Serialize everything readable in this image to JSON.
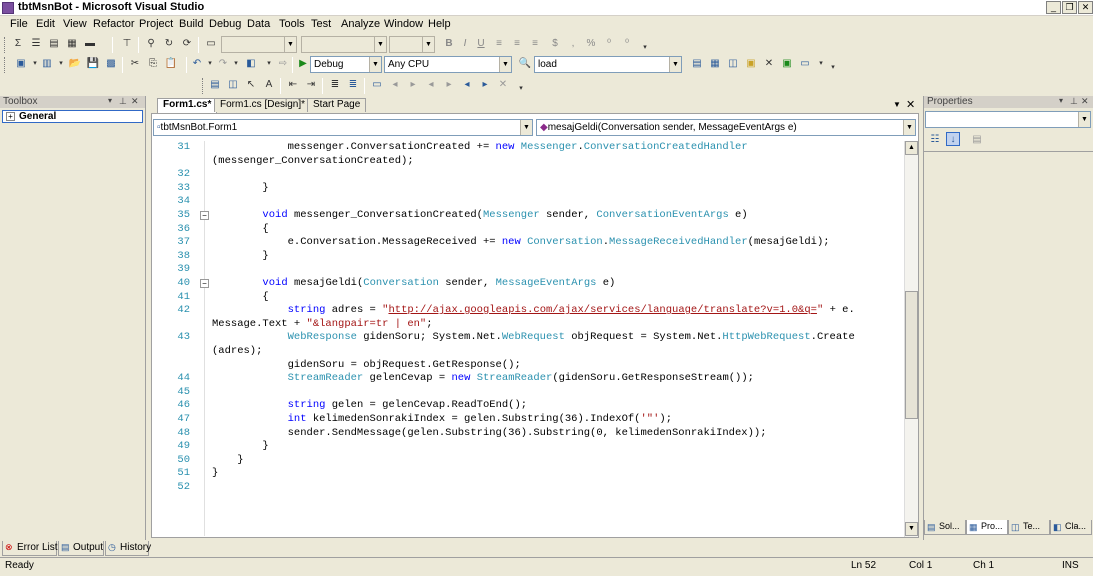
{
  "window": {
    "title": "tbtMsnBot - Microsoft Visual Studio"
  },
  "menu": [
    "File",
    "Edit",
    "View",
    "Refactor",
    "Project",
    "Build",
    "Debug",
    "Data",
    "Tools",
    "Test",
    "Analyze",
    "Window",
    "Help"
  ],
  "toolbar": {
    "config": "Debug",
    "platform": "Any CPU",
    "find": "load"
  },
  "toolbox": {
    "title": "Toolbox",
    "group": "General"
  },
  "tabs": [
    "Form1.cs*",
    "Form1.cs [Design]*",
    "Start Page"
  ],
  "nav": {
    "class": "tbtMsnBot.Form1",
    "member": "mesajGeldi(Conversation sender, MessageEventArgs e)"
  },
  "properties": {
    "title": "Properties"
  },
  "code": {
    "lines": [
      {
        "n": "31",
        "t": "            messenger.ConversationCreated += new Messenger.ConversationCreatedHandler"
      },
      {
        "n": "",
        "t": "(messenger_ConversationCreated);"
      },
      {
        "n": "32",
        "t": ""
      },
      {
        "n": "33",
        "t": "        }"
      },
      {
        "n": "34",
        "t": ""
      },
      {
        "n": "35",
        "t": "        void messenger_ConversationCreated(Messenger sender, ConversationEventArgs e)"
      },
      {
        "n": "36",
        "t": "        {"
      },
      {
        "n": "37",
        "t": "            e.Conversation.MessageReceived += new Conversation.MessageReceivedHandler(mesajGeldi);"
      },
      {
        "n": "38",
        "t": "        }"
      },
      {
        "n": "39",
        "t": ""
      },
      {
        "n": "40",
        "t": "        void mesajGeldi(Conversation sender, MessageEventArgs e)"
      },
      {
        "n": "41",
        "t": "        {"
      },
      {
        "n": "42",
        "t": "            string adres = \"http://ajax.googleapis.com/ajax/services/language/translate?v=1.0&q=\" + e."
      },
      {
        "n": "",
        "t": "Message.Text + \"&langpair=tr | en\";"
      },
      {
        "n": "43",
        "t": "            WebResponse gidenSoru; System.Net.WebRequest objRequest = System.Net.HttpWebRequest.Create"
      },
      {
        "n": "",
        "t": "(adres);"
      },
      {
        "n": "",
        "t": "            gidenSoru = objRequest.GetResponse();"
      },
      {
        "n": "44",
        "t": "            StreamReader gelenCevap = new StreamReader(gidenSoru.GetResponseStream());"
      },
      {
        "n": "45",
        "t": ""
      },
      {
        "n": "46",
        "t": "            string gelen = gelenCevap.ReadToEnd();"
      },
      {
        "n": "47",
        "t": "            int kelimedenSonrakiIndex = gelen.Substring(36).IndexOf('\"');"
      },
      {
        "n": "48",
        "t": "            sender.SendMessage(gelen.Substring(36).Substring(0, kelimedenSonrakiIndex));"
      },
      {
        "n": "49",
        "t": "        }"
      },
      {
        "n": "50",
        "t": "    }"
      },
      {
        "n": "51",
        "t": "}"
      },
      {
        "n": "52",
        "t": ""
      }
    ]
  },
  "bottomTabs": [
    "Error List",
    "Output",
    "History"
  ],
  "sideTabs": [
    "Sol...",
    "Pro...",
    "Te...",
    "Cla..."
  ],
  "status": {
    "ready": "Ready",
    "ln": "Ln 52",
    "col": "Col 1",
    "ch": "Ch 1",
    "ins": "INS"
  }
}
